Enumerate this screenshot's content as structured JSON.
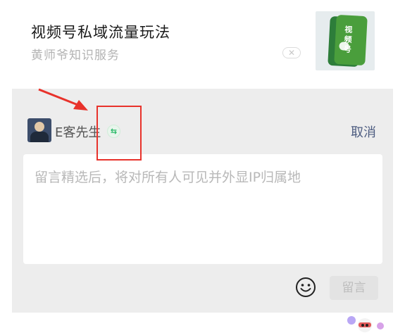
{
  "ad": {
    "title": "视频号私域流量玩法",
    "subtitle": "黄师爷知识服务",
    "close_glyph": "✕",
    "thumbnail_text": "视频号"
  },
  "comment": {
    "username": "E客先生",
    "switch_glyph": "⇆",
    "cancel_label": "取消",
    "placeholder": "留言精选后，将对所有人可见并外显IP归属地",
    "value": "",
    "submit_label": "留言",
    "emoji_icon": "smiley-face-icon"
  },
  "colors": {
    "annotation": "#e8322b",
    "link": "#4d5c80",
    "switch_green": "#25b864",
    "panel_bg": "#ededed"
  }
}
